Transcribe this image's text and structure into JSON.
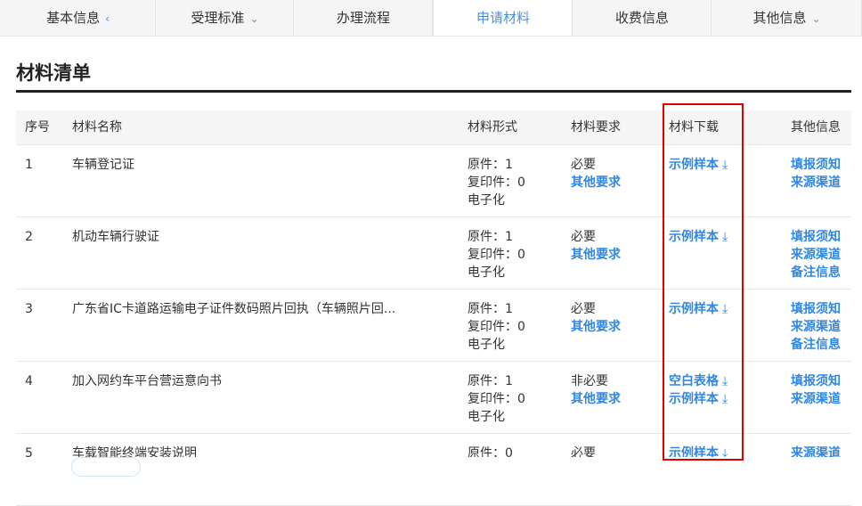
{
  "tabs": [
    {
      "label": "基本信息",
      "caret": "‹"
    },
    {
      "label": "受理标准",
      "caret": "⌄"
    },
    {
      "label": "办理流程",
      "caret": ""
    },
    {
      "label": "申请材料",
      "caret": ""
    },
    {
      "label": "收费信息",
      "caret": ""
    },
    {
      "label": "其他信息",
      "caret": "⌄"
    }
  ],
  "section": {
    "title": "材料清单"
  },
  "table": {
    "headers": {
      "no": "序号",
      "name": "材料名称",
      "form": "材料形式",
      "req": "材料要求",
      "dl": "材料下载",
      "other": "其他信息"
    },
    "rows": [
      {
        "no": "1",
        "name": "车辆登记证",
        "form": [
          "原件：1",
          "复印件：0",
          "电子化"
        ],
        "req": "必要",
        "req_link": "其他要求",
        "dl": [
          "示例样本"
        ],
        "other": [
          "填报须知",
          "来源渠道"
        ]
      },
      {
        "no": "2",
        "name": "机动车辆行驶证",
        "form": [
          "原件：1",
          "复印件：0",
          "电子化"
        ],
        "req": "必要",
        "req_link": "其他要求",
        "dl": [
          "示例样本"
        ],
        "other": [
          "填报须知",
          "来源渠道",
          "备注信息"
        ]
      },
      {
        "no": "3",
        "name": "广东省IC卡道路运输电子证件数码照片回执（车辆照片回...",
        "form": [
          "原件：1",
          "复印件：0",
          "电子化"
        ],
        "req": "必要",
        "req_link": "其他要求",
        "dl": [
          "示例样本"
        ],
        "other": [
          "填报须知",
          "来源渠道",
          "备注信息"
        ]
      },
      {
        "no": "4",
        "name": "加入网约车平台营运意向书",
        "form": [
          "原件：1",
          "复印件：0",
          "电子化"
        ],
        "req": "非必要",
        "req_link": "其他要求",
        "dl": [
          "空白表格",
          "示例样本"
        ],
        "other": [
          "填报须知",
          "来源渠道"
        ]
      },
      {
        "no": "5",
        "name": "车载智能终端安装说明",
        "form": [
          "原件：0"
        ],
        "req": "必要",
        "req_link": "",
        "dl": [
          "示例样本"
        ],
        "other": [
          "来源渠道"
        ]
      }
    ]
  },
  "icons": {
    "download": "download-icon"
  },
  "colors": {
    "link": "#2f87e6",
    "active_tab": "#4a90e2",
    "highlight": "#e00000"
  }
}
